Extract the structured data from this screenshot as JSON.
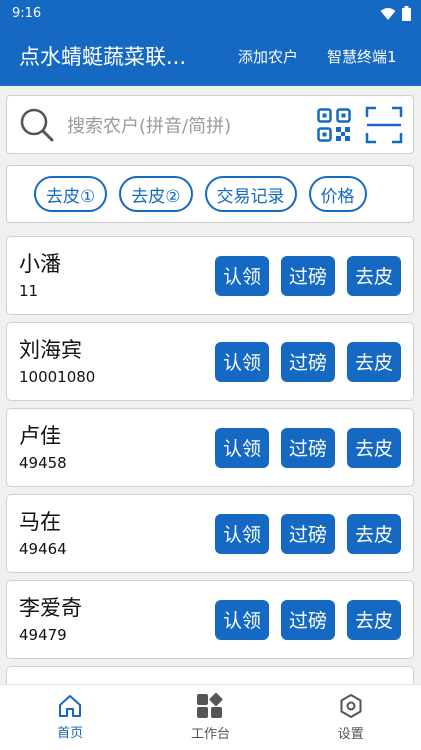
{
  "status_bar": {
    "time": "9:16"
  },
  "app_bar": {
    "title": "点水蜻蜓蔬菜联...",
    "add_farmer": "添加农户",
    "terminal": "智慧终端1"
  },
  "search": {
    "placeholder": "搜索农户(拼音/简拼)"
  },
  "chips": [
    {
      "label": "去皮①"
    },
    {
      "label": "去皮②"
    },
    {
      "label": "交易记录"
    },
    {
      "label": "价格"
    }
  ],
  "farmers": [
    {
      "name": "小潘",
      "id": "11"
    },
    {
      "name": "刘海宾",
      "id": "10001080"
    },
    {
      "name": "卢佳",
      "id": "49458"
    },
    {
      "name": "马在",
      "id": "49464"
    },
    {
      "name": "李爱奇",
      "id": "49479"
    }
  ],
  "card_buttons": {
    "claim": "认领",
    "weigh": "过磅",
    "tare": "去皮"
  },
  "nav": [
    {
      "label": "首页",
      "icon": "home-icon",
      "active": true
    },
    {
      "label": "工作台",
      "icon": "dashboard-icon",
      "active": false
    },
    {
      "label": "设置",
      "icon": "settings-icon",
      "active": false
    }
  ],
  "colors": {
    "primary": "#1569c2",
    "background": "#f0f0f0"
  }
}
